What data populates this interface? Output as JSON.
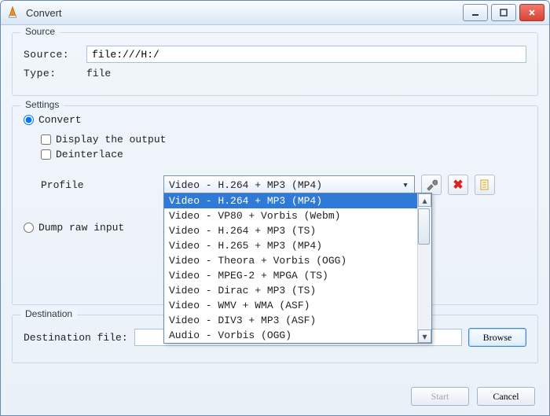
{
  "window": {
    "title": "Convert"
  },
  "groups": {
    "source_legend": "Source",
    "settings_legend": "Settings",
    "destination_legend": "Destination"
  },
  "source": {
    "source_label": "Source:",
    "source_value": "file:///H:/",
    "type_label": "Type:",
    "type_value": "file"
  },
  "settings": {
    "convert_label": "Convert",
    "display_output_label": "Display the output",
    "deinterlace_label": "Deinterlace",
    "profile_label": "Profile",
    "profile_selected": "Video - H.264 + MP3 (MP4)",
    "profile_options": [
      "Video - H.264 + MP3 (MP4)",
      "Video - VP80 + Vorbis (Webm)",
      "Video - H.264 + MP3 (TS)",
      "Video - H.265 + MP3 (MP4)",
      "Video - Theora + Vorbis (OGG)",
      "Video - MPEG-2 + MPGA (TS)",
      "Video - Dirac + MP3 (TS)",
      "Video - WMV + WMA (ASF)",
      "Video - DIV3 + MP3 (ASF)",
      "Audio - Vorbis (OGG)"
    ],
    "dump_raw_label": "Dump raw input"
  },
  "destination": {
    "file_label": "Destination file:",
    "file_value": "",
    "browse_label": "Browse"
  },
  "buttons": {
    "start": "Start",
    "cancel": "Cancel"
  },
  "tool_icons": {
    "edit": "edit profile",
    "delete": "delete profile",
    "new": "new profile"
  }
}
